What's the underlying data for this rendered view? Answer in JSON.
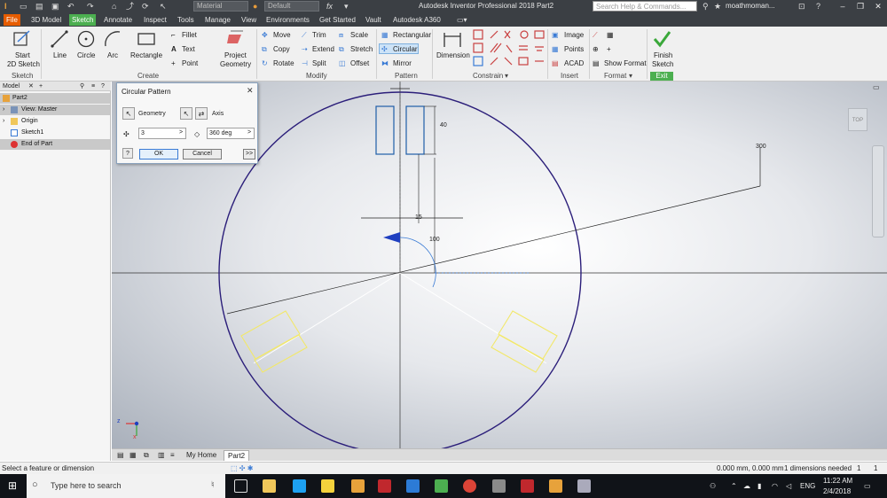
{
  "titlebar": {
    "appearance_combo": "Material",
    "style_combo": "Default",
    "app_title": "Autodesk Inventor Professional 2018    Part2",
    "search_placeholder": "Search Help & Commands...",
    "user": "moathmoman..."
  },
  "tabs": [
    "File",
    "3D Model",
    "Sketch",
    "Annotate",
    "Inspect",
    "Tools",
    "Manage",
    "View",
    "Environments",
    "Get Started",
    "Vault",
    "Autodesk A360"
  ],
  "ribbon": {
    "sketch": {
      "start_line1": "Start",
      "start_line2": "2D Sketch",
      "title": "Sketch"
    },
    "create": {
      "line": "Line",
      "circle": "Circle",
      "arc": "Arc",
      "rectangle": "Rectangle",
      "fillet": "Fillet",
      "text": "Text",
      "point": "Point",
      "project_line1": "Project",
      "project_line2": "Geometry",
      "title": "Create"
    },
    "modify": {
      "move": "Move",
      "copy": "Copy",
      "rotate": "Rotate",
      "trim": "Trim",
      "extend": "Extend",
      "split": "Split",
      "scale": "Scale",
      "stretch": "Stretch",
      "offset": "Offset",
      "title": "Modify"
    },
    "pattern": {
      "rectangular": "Rectangular",
      "circular": "Circular",
      "mirror": "Mirror",
      "title": "Pattern"
    },
    "constrain": {
      "dimension": "Dimension",
      "title": "Constrain"
    },
    "insert": {
      "image": "Image",
      "points": "Points",
      "acad": "ACAD",
      "title": "Insert"
    },
    "format": {
      "show_format": "Show Format",
      "title": "Format"
    },
    "exit": {
      "finish_line1": "Finish",
      "finish_line2": "Sketch",
      "title": "Exit"
    }
  },
  "browser": {
    "tab": "Model",
    "items": [
      "Part2",
      "View: Master",
      "Origin",
      "Sketch1",
      "End of Part"
    ]
  },
  "dialog": {
    "title": "Circular Pattern",
    "geometry_label": "Geometry",
    "axis_label": "Axis",
    "count": "3",
    "angle": "360 deg",
    "ok": "OK",
    "cancel": "Cancel",
    "more": ">>"
  },
  "canvas": {
    "dim_40": "40",
    "dim_15": "15",
    "dim_100": "100",
    "dim_300": "300",
    "viewcube": "TOP",
    "axis_z": "z",
    "axis_x": "x"
  },
  "doctabs": {
    "home": "My Home",
    "part": "Part2"
  },
  "status": {
    "left": "Select a feature or dimension",
    "coords": "0.000 mm, 0.000 mm",
    "dims": "1 dimensions needed",
    "count_a": "1",
    "count_b": "1"
  },
  "taskbar": {
    "search": "Type here to search",
    "lang": "ENG",
    "time": "11:22 AM",
    "date": "2/4/2018"
  },
  "colors": {
    "titlebar": "#3b3f44",
    "file_tab": "#e65c00",
    "sketch_tab": "#4caf50",
    "circle": "#2b1e7a",
    "selected_geometry": "#f2e86a"
  }
}
